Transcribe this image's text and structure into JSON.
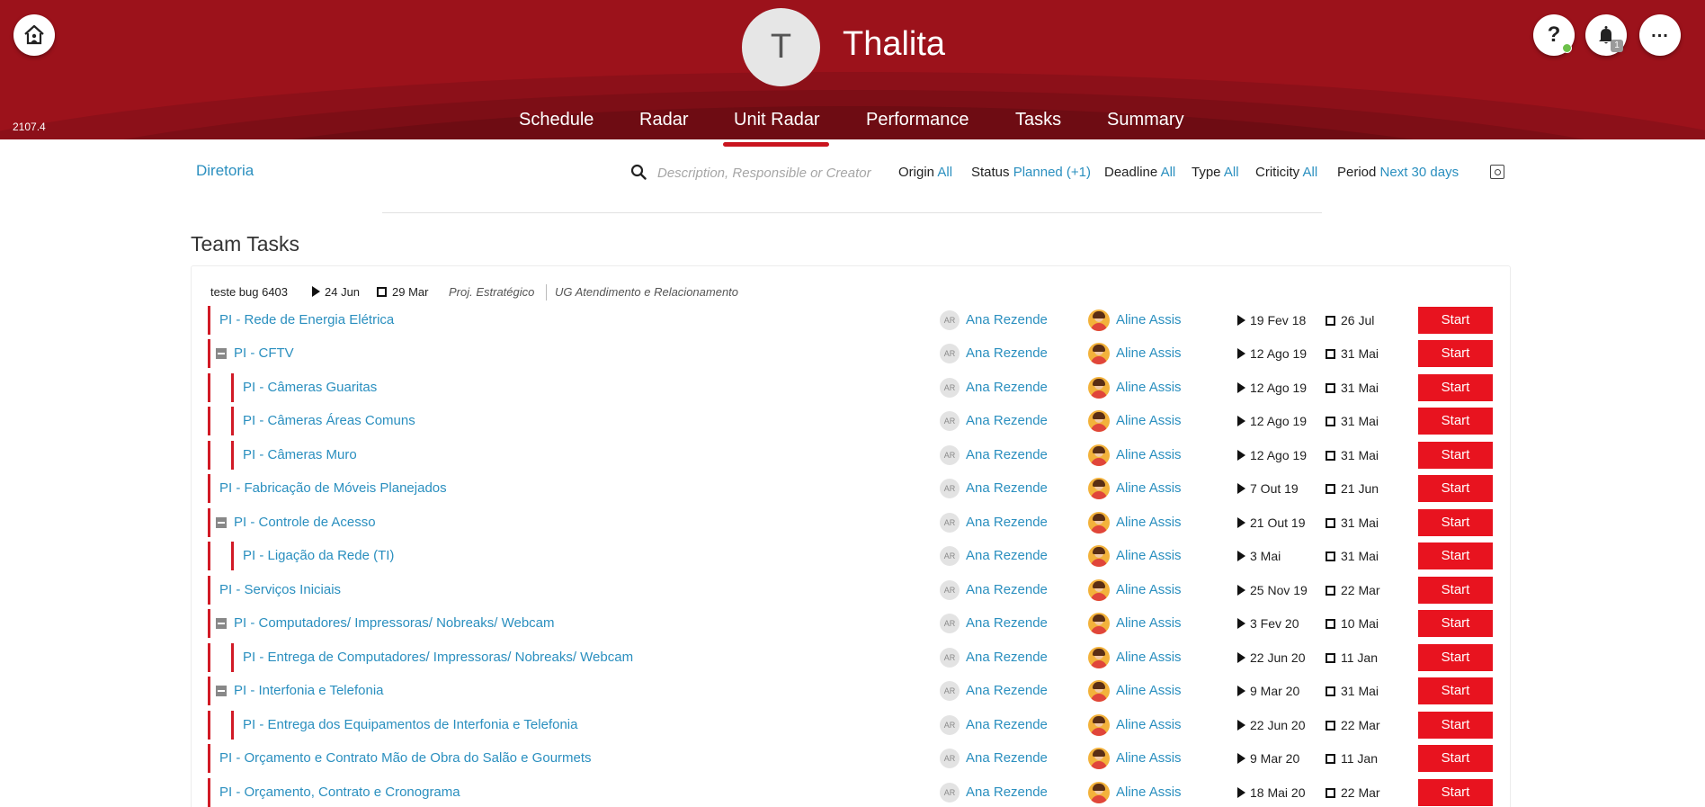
{
  "app": {
    "version": "2107.4",
    "user_initial": "T",
    "user_name": "Thalita",
    "notification_count": "1",
    "help_glyph": "?",
    "more_glyph": "..."
  },
  "nav": {
    "tabs": [
      {
        "label": "Schedule"
      },
      {
        "label": "Radar"
      },
      {
        "label": "Unit Radar",
        "active": true
      },
      {
        "label": "Performance"
      },
      {
        "label": "Tasks"
      },
      {
        "label": "Summary"
      }
    ]
  },
  "filters": {
    "unit": "Diretoria",
    "search_placeholder": "Description, Responsible or Creator",
    "origin": {
      "label": "Origin",
      "value": "All"
    },
    "status": {
      "label": "Status",
      "value": "Planned (+1)"
    },
    "deadline": {
      "label": "Deadline",
      "value": "All"
    },
    "type": {
      "label": "Type",
      "value": "All"
    },
    "criticity": {
      "label": "Criticity",
      "value": "All"
    },
    "period": {
      "label": "Period",
      "value": "Next 30 days"
    }
  },
  "section": {
    "title": "Team Tasks"
  },
  "group": {
    "title": "teste bug 6403",
    "start": "24 Jun",
    "end": "29 Mar",
    "project": "Proj. Estratégico",
    "unit": "UG Atendimento e Relacionamento"
  },
  "labels": {
    "responsible_initials": "AR",
    "start_button": "Start"
  },
  "tasks": [
    {
      "title": "PI - Rede de Energia Elétrica",
      "level": 0,
      "collapsible": false,
      "responsible": "Ana Rezende",
      "creator": "Aline Assis",
      "start": "19 Fev 18",
      "end": "26 Jul"
    },
    {
      "title": "PI - CFTV",
      "level": 0,
      "collapsible": true,
      "responsible": "Ana Rezende",
      "creator": "Aline Assis",
      "start": "12 Ago 19",
      "end": "31 Mai"
    },
    {
      "title": "PI - Câmeras Guaritas",
      "level": 1,
      "collapsible": false,
      "responsible": "Ana Rezende",
      "creator": "Aline Assis",
      "start": "12 Ago 19",
      "end": "31 Mai"
    },
    {
      "title": "PI - Câmeras Áreas Comuns",
      "level": 1,
      "collapsible": false,
      "responsible": "Ana Rezende",
      "creator": "Aline Assis",
      "start": "12 Ago 19",
      "end": "31 Mai"
    },
    {
      "title": "PI - Câmeras Muro",
      "level": 1,
      "collapsible": false,
      "responsible": "Ana Rezende",
      "creator": "Aline Assis",
      "start": "12 Ago 19",
      "end": "31 Mai"
    },
    {
      "title": "PI - Fabricação de Móveis Planejados",
      "level": 0,
      "collapsible": false,
      "responsible": "Ana Rezende",
      "creator": "Aline Assis",
      "start": "7 Out 19",
      "end": "21 Jun"
    },
    {
      "title": "PI - Controle de Acesso",
      "level": 0,
      "collapsible": true,
      "responsible": "Ana Rezende",
      "creator": "Aline Assis",
      "start": "21 Out 19",
      "end": "31 Mai"
    },
    {
      "title": "PI - Ligação da Rede (TI)",
      "level": 1,
      "collapsible": false,
      "responsible": "Ana Rezende",
      "creator": "Aline Assis",
      "start": "3 Mai",
      "end": "31 Mai"
    },
    {
      "title": "PI - Serviços Iniciais",
      "level": 0,
      "collapsible": false,
      "responsible": "Ana Rezende",
      "creator": "Aline Assis",
      "start": "25 Nov 19",
      "end": "22 Mar"
    },
    {
      "title": "PI - Computadores/ Impressoras/ Nobreaks/ Webcam",
      "level": 0,
      "collapsible": true,
      "responsible": "Ana Rezende",
      "creator": "Aline Assis",
      "start": "3 Fev 20",
      "end": "10 Mai"
    },
    {
      "title": "PI - Entrega de Computadores/ Impressoras/ Nobreaks/ Webcam",
      "level": 1,
      "collapsible": false,
      "responsible": "Ana Rezende",
      "creator": "Aline Assis",
      "start": "22 Jun 20",
      "end": "11 Jan"
    },
    {
      "title": "PI - Interfonia e Telefonia",
      "level": 0,
      "collapsible": true,
      "responsible": "Ana Rezende",
      "creator": "Aline Assis",
      "start": "9 Mar 20",
      "end": "31 Mai"
    },
    {
      "title": "PI - Entrega dos Equipamentos de Interfonia e Telefonia",
      "level": 1,
      "collapsible": false,
      "responsible": "Ana Rezende",
      "creator": "Aline Assis",
      "start": "22 Jun 20",
      "end": "22 Mar"
    },
    {
      "title": "PI - Orçamento e Contrato Mão de Obra do Salão e Gourmets",
      "level": 0,
      "collapsible": false,
      "responsible": "Ana Rezende",
      "creator": "Aline Assis",
      "start": "9 Mar 20",
      "end": "11 Jan"
    },
    {
      "title": "PI - Orçamento, Contrato e Cronograma",
      "level": 0,
      "collapsible": false,
      "responsible": "Ana Rezende",
      "creator": "Aline Assis",
      "start": "18 Mai 20",
      "end": "22 Mar"
    }
  ],
  "colors": {
    "header_red": "#9c121b",
    "accent_blue": "#2a8fbf",
    "start_button_red": "#e8131f",
    "task_bar_red": "#d11a26"
  }
}
